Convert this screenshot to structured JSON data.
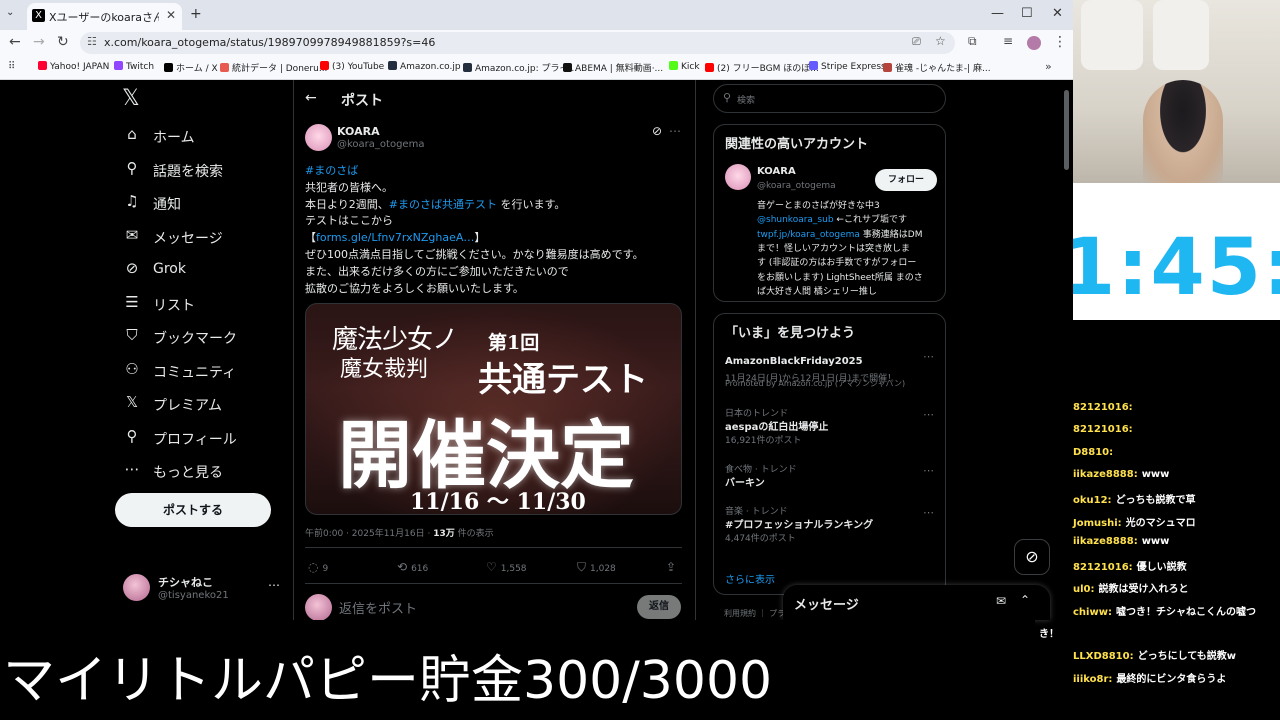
{
  "browser": {
    "tab_title": "Xユーザーのkoaraさん: 「#まのさば",
    "tab_favicon": "X",
    "url": "x.com/koara_otogema/status/1989709978949881859?s=46",
    "bookmarks": [
      {
        "label": "Yahoo! JAPAN",
        "color": "#ff0033"
      },
      {
        "label": "Twitch",
        "color": "#9146ff"
      },
      {
        "label": "ホーム / X",
        "color": "#000000"
      },
      {
        "label": "統計データ | Doneru...",
        "color": "#e85a4f"
      },
      {
        "label": "(3) YouTube",
        "color": "#ff0000"
      },
      {
        "label": "Amazon.co.jp",
        "color": "#232f3e"
      },
      {
        "label": "Amazon.co.jp: プライ...",
        "color": "#232f3e"
      },
      {
        "label": "ABEMA | 無料動画·...",
        "color": "#111111"
      },
      {
        "label": "Kick",
        "color": "#53fc18"
      },
      {
        "label": "(2) フリーBGM ほのぼ...",
        "color": "#ff0000"
      },
      {
        "label": "Stripe Express",
        "color": "#635bff"
      },
      {
        "label": "雀魂 -じゃんたま-| 麻...",
        "color": "#b5443c"
      }
    ]
  },
  "sidebar": {
    "logo": "𝕏",
    "items": [
      {
        "icon": "home-icon",
        "glyph": "⌂",
        "label": "ホーム"
      },
      {
        "icon": "search-icon",
        "glyph": "⚲",
        "label": "話題を検索"
      },
      {
        "icon": "bell-icon",
        "glyph": "♫",
        "label": "通知"
      },
      {
        "icon": "mail-icon",
        "glyph": "✉",
        "label": "メッセージ"
      },
      {
        "icon": "grok-icon",
        "glyph": "⊘",
        "label": "Grok"
      },
      {
        "icon": "list-icon",
        "glyph": "☰",
        "label": "リスト"
      },
      {
        "icon": "bookmark-icon",
        "glyph": "⛉",
        "label": "ブックマーク"
      },
      {
        "icon": "community-icon",
        "glyph": "⚇",
        "label": "コミュニティ"
      },
      {
        "icon": "x-icon",
        "glyph": "𝕏",
        "label": "プレミアム"
      },
      {
        "icon": "profile-icon",
        "glyph": "⚲",
        "label": "プロフィール"
      },
      {
        "icon": "more-icon",
        "glyph": "⋯",
        "label": "もっと見る"
      }
    ],
    "post_button": "ポストする",
    "account": {
      "name": "チシャねこ",
      "handle": "@tisyaneko21"
    }
  },
  "post": {
    "header": "ポスト",
    "back_glyph": "←",
    "author": {
      "name": "KOARA",
      "handle": "@koara_otogema"
    },
    "lines": [
      {
        "parts": [
          {
            "t": "#まのさば",
            "link": true
          }
        ]
      },
      {
        "parts": [
          {
            "t": "共犯者の皆様へ。",
            "link": false
          }
        ]
      },
      {
        "parts": [
          {
            "t": "本日より2週間、",
            "link": false
          },
          {
            "t": "#まのさば共通テスト",
            "link": true
          },
          {
            "t": " を行います。",
            "link": false
          }
        ]
      },
      {
        "parts": [
          {
            "t": "テストはここから",
            "link": false
          }
        ]
      },
      {
        "parts": [
          {
            "t": "【",
            "link": false
          },
          {
            "t": "forms.gle/Lfnv7rxNZghaeA…",
            "link": true
          },
          {
            "t": "】",
            "link": false
          }
        ]
      },
      {
        "parts": [
          {
            "t": "ぜひ100点満点目指してご挑戦ください。かなり難易度は高めです。",
            "link": false
          }
        ]
      },
      {
        "parts": [
          {
            "t": "また、出来るだけ多くの方にご参加いただきたいので",
            "link": false
          }
        ]
      },
      {
        "parts": [
          {
            "t": "拡散のご協力をよろしくお願いいたします。",
            "link": false
          }
        ]
      }
    ],
    "image": {
      "logo_line1": "魔法少女ノ",
      "logo_line2": "魔女裁判",
      "edition": "第1回",
      "subtitle": "共通テスト",
      "headline": "開催決定",
      "dates": "11/16 ～ 11/30"
    },
    "meta": {
      "time": "午前0:00 · 2025年11月16日 · ",
      "views": "13万",
      "views_suffix": " 件の表示"
    },
    "actions": [
      {
        "name": "reply",
        "glyph": "◌",
        "count": "9"
      },
      {
        "name": "repost",
        "glyph": "⟲",
        "count": "616"
      },
      {
        "name": "like",
        "glyph": "♡",
        "count": "1,558"
      },
      {
        "name": "bookmark",
        "glyph": "⛉",
        "count": "1,028"
      },
      {
        "name": "share",
        "glyph": "⇪",
        "count": ""
      }
    ],
    "reply_placeholder": "返信をポスト",
    "reply_button": "返信"
  },
  "right": {
    "search_placeholder": "検索",
    "related_title": "関連性の高いアカウント",
    "related": {
      "name": "KOARA",
      "handle": "@koara_otogema",
      "follow": "フォロー",
      "bio": [
        {
          "parts": [
            {
              "t": "音ゲーとまのさばが好きな中3",
              "link": false
            }
          ]
        },
        {
          "parts": [
            {
              "t": "@shunkoara_sub",
              "link": true
            },
            {
              "t": " ←これサブ垢です",
              "link": false
            }
          ]
        },
        {
          "parts": [
            {
              "t": "twpf.jp/koara_otogema",
              "link": true
            },
            {
              "t": " 事務連絡はDM",
              "link": false
            }
          ]
        },
        {
          "parts": [
            {
              "t": "まで！怪しいアカウントは突き放しま",
              "link": false
            }
          ]
        },
        {
          "parts": [
            {
              "t": "す (非認証の方はお手数ですがフォロー",
              "link": false
            }
          ]
        },
        {
          "parts": [
            {
              "t": "をお願いします) LightSheet所属 まのさ",
              "link": false
            }
          ]
        },
        {
          "parts": [
            {
              "t": "ば大好き人間 橘シェリー推し",
              "link": false
            }
          ]
        }
      ]
    },
    "trends_title": "「いま」を見つけよう",
    "trends": [
      {
        "cat": "",
        "title": "AmazonBlackFriday2025",
        "sub": "11月24日(月)から12月1日(月)まで開催！"
      },
      {
        "cat": "日本のトレンド",
        "title": "aespaの紅白出場停止",
        "sub": "16,921件のポスト"
      },
      {
        "cat": "食べ物 · トレンド",
        "title": "バーキン",
        "sub": ""
      },
      {
        "cat": "音楽 · トレンド",
        "title": "#プロフェッショナルランキング",
        "sub": "4,474件のポスト"
      }
    ],
    "promoted": "Promoted by Amazon.co.jp (アマゾンジャパン)",
    "show_more": "さらに表示",
    "footer": "利用規約 ｜ プラ"
  },
  "message_drawer": {
    "title": "メッセージ"
  },
  "stream": {
    "timer": "1:45:",
    "chat": [
      {
        "user": "82121016:",
        "text": ""
      },
      {
        "user": "82121016:",
        "text": ""
      },
      {
        "user": "D8810:",
        "text": ""
      },
      {
        "user": "iikaze8888:",
        "text": "www"
      },
      {
        "user": "oku12:",
        "text": "どっちも説教で草"
      },
      {
        "user": "Jomushi:",
        "text": "光のマシュマロ"
      },
      {
        "user": "iikaze8888:",
        "text": "www"
      },
      {
        "user": "82121016:",
        "text": "優しい説教"
      },
      {
        "user": "ul0:",
        "text": "説教は受け入れろと"
      },
      {
        "user": "chiww:",
        "text": "嘘つき！チシャねこくんの嘘つ"
      },
      {
        "user": "",
        "text": "き！"
      },
      {
        "user": "LLXD8810:",
        "text": "どっちにしても説教w"
      },
      {
        "user": "iiiko8r:",
        "text": "最終的にビンタ食らうよ"
      }
    ],
    "caption": "マイリトルパピー貯金300/3000"
  },
  "colors": {
    "accent": "#1d9bf0",
    "timer": "#1fb7f2",
    "chat_user": "#ffe14d"
  }
}
